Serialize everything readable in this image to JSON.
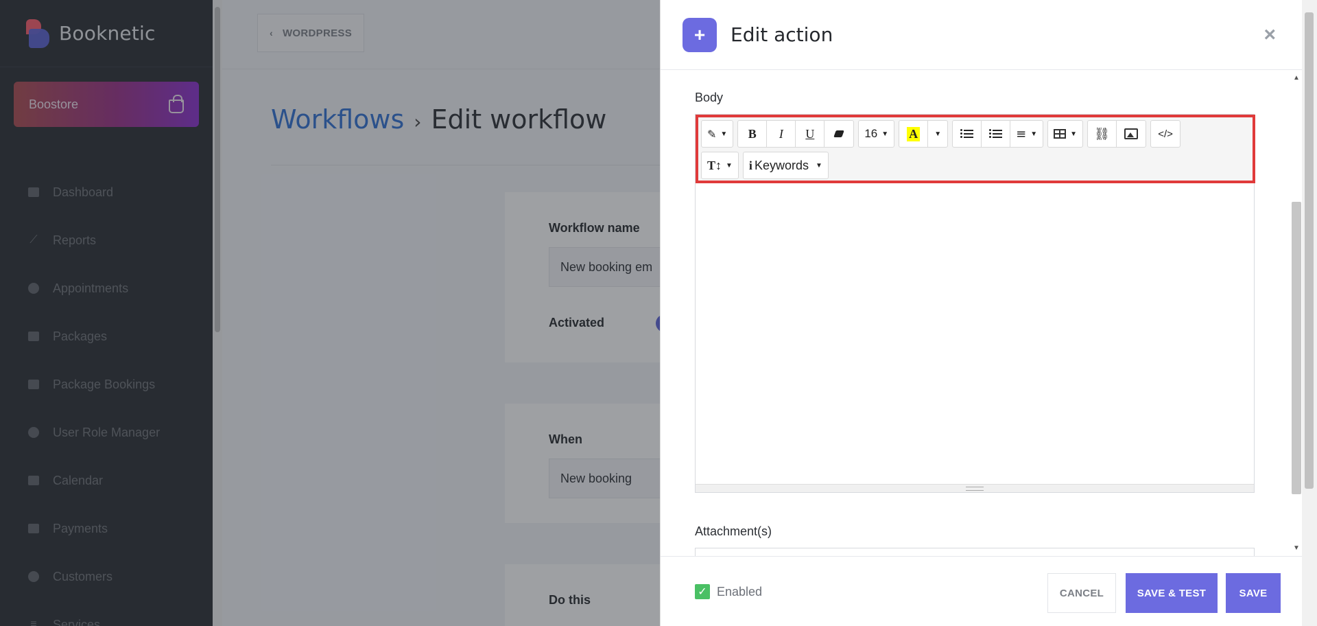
{
  "sidebar": {
    "brand": "Booknetic",
    "boostore": "Boostore",
    "items": [
      {
        "label": "Dashboard"
      },
      {
        "label": "Reports"
      },
      {
        "label": "Appointments"
      },
      {
        "label": "Packages"
      },
      {
        "label": "Package Bookings"
      },
      {
        "label": "User Role Manager"
      },
      {
        "label": "Calendar"
      },
      {
        "label": "Payments"
      },
      {
        "label": "Customers"
      },
      {
        "label": "Services"
      }
    ]
  },
  "main": {
    "wordpress_btn": "WORDPRESS",
    "breadcrumb": {
      "link": "Workflows",
      "separator": "›",
      "current": "Edit workflow"
    },
    "workflow_name_label": "Workflow name",
    "workflow_name_value": "New booking em",
    "activated_label": "Activated",
    "when_label": "When",
    "when_value": "New booking",
    "do_this_label": "Do this"
  },
  "panel": {
    "title": "Edit action",
    "close": "×",
    "body_label": "Body",
    "toolbar": {
      "font_size": "16",
      "keywords": "Keywords",
      "code": "</>"
    },
    "attachments_label": "Attachment(s)",
    "enabled_label": "Enabled",
    "cancel": "CANCEL",
    "save_test": "SAVE & TEST",
    "save": "SAVE"
  },
  "colors": {
    "accent": "#6c6be0",
    "highlight": "#e03a3a",
    "sidebar": "#292d32"
  }
}
